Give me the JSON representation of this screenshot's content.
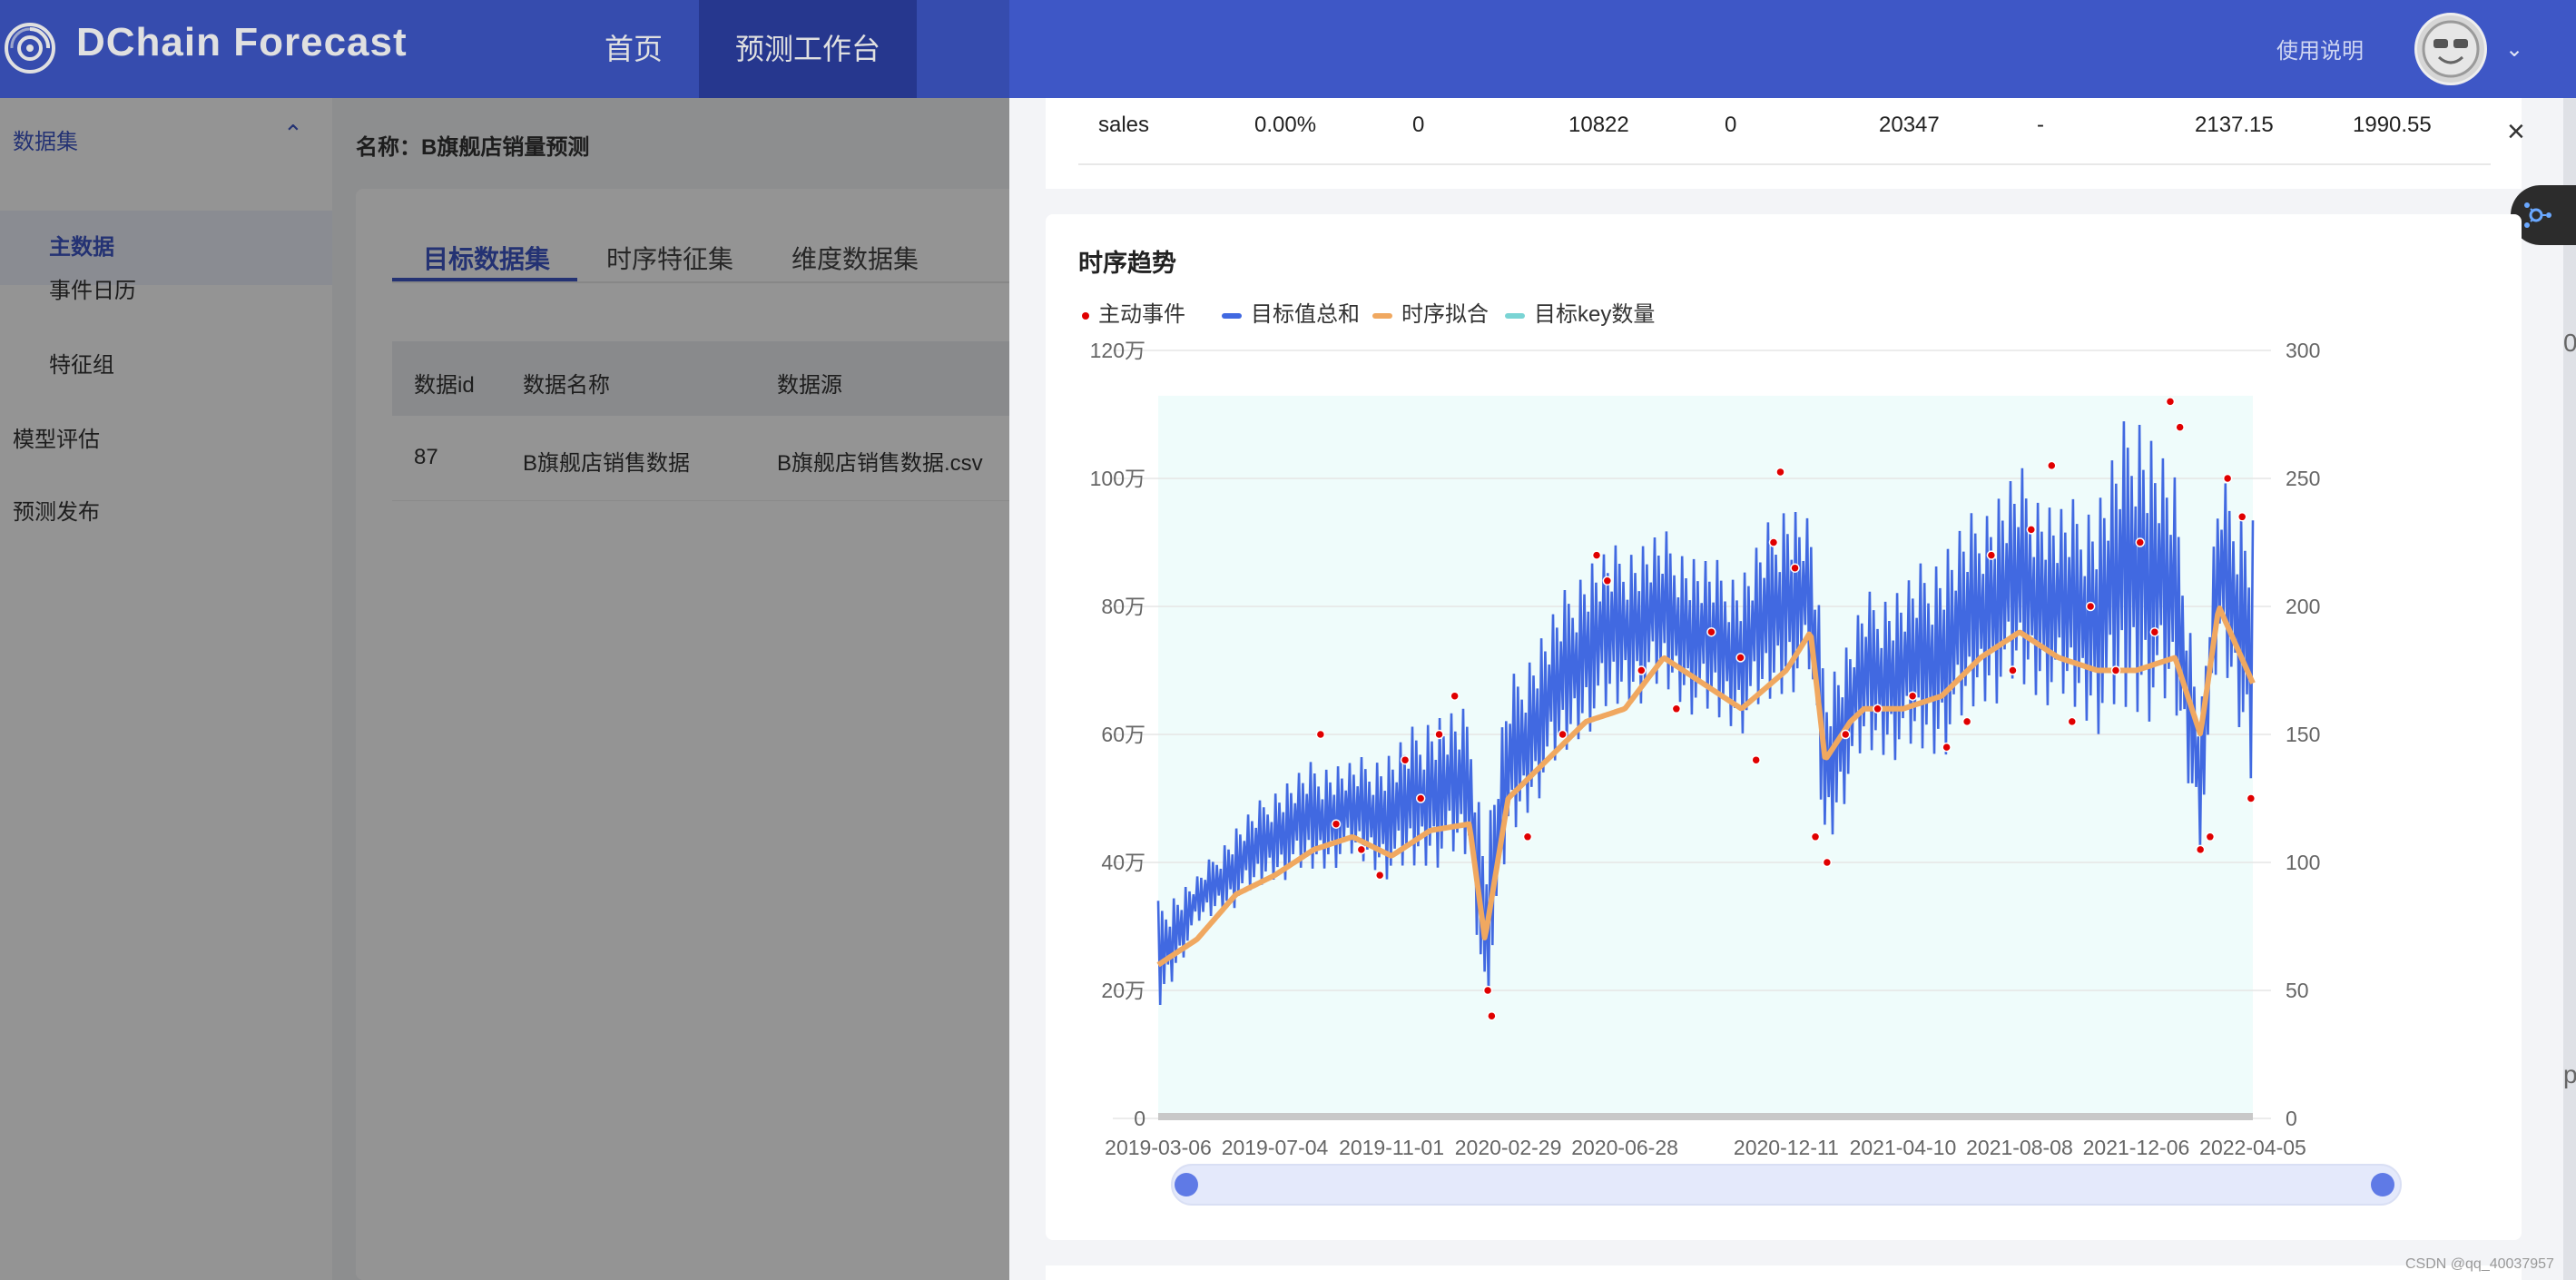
{
  "brand": {
    "name": "DChain Forecast",
    "logo_icon": "swirl-logo-icon"
  },
  "nav": {
    "home": "首页",
    "workbench": "预测工作台",
    "help": "使用说明",
    "avatar_icon": "smiley-avatar-icon",
    "dropdown_icon": "chevron-down-icon"
  },
  "sidebar": {
    "group": "数据集",
    "items": [
      "主数据",
      "事件日历",
      "特征组"
    ],
    "other": [
      "模型评估",
      "预测发布"
    ]
  },
  "main": {
    "dataset_name": "名称：B旗舰店销量预测",
    "tabs": [
      "目标数据集",
      "时序特征集",
      "维度数据集"
    ],
    "table": {
      "headers": [
        "数据id",
        "数据名称",
        "数据源"
      ],
      "rows": [
        [
          "87",
          "B旗舰店销售数据",
          "B旗舰店销售数据.csv"
        ]
      ]
    }
  },
  "drawer": {
    "close_icon": "close-icon",
    "float_icon": "graph-network-icon",
    "stats_row": [
      "sales",
      "0.00%",
      "0",
      "10822",
      "0",
      "20347",
      "-",
      "2137.15",
      "1990.55"
    ],
    "chart_title": "时序趋势",
    "edge_chars": [
      "0",
      "p"
    ],
    "watermark": "CSDN @qq_40037957"
  },
  "colors": {
    "primary": "#3e57c6",
    "series_total": "#4169e1",
    "series_fit": "#f0a860",
    "series_keys": "#7ad4d4",
    "events": "#e00000",
    "plot_bg": "#effcfb"
  },
  "chart_data": {
    "type": "line",
    "title": "时序趋势",
    "legend": [
      "主动事件",
      "目标值总和",
      "时序拟合",
      "目标key数量"
    ],
    "legend_position": "top-left",
    "x_tick_labels": [
      "2019-03-06",
      "2019-07-04",
      "2019-11-01",
      "2020-02-29",
      "2020-06-28",
      "2020-12-11",
      "2021-04-10",
      "2021-08-08",
      "2021-12-06",
      "2022-04-05"
    ],
    "x_range": [
      "2019-03-06",
      "2022-04-05"
    ],
    "y_left_ticks": [
      "0",
      "20万",
      "40万",
      "60万",
      "80万",
      "100万",
      "120万"
    ],
    "y_left_range": [
      0,
      1200000
    ],
    "y_right_ticks": [
      "0",
      "50",
      "100",
      "150",
      "200",
      "250",
      "300"
    ],
    "y_right_range": [
      0,
      300
    ],
    "series": [
      {
        "name": "目标值总和",
        "axis": "left",
        "x": [
          "2019-03-06",
          "2019-04-15",
          "2019-05-25",
          "2019-07-04",
          "2019-08-13",
          "2019-09-22",
          "2019-11-01",
          "2019-12-11",
          "2020-01-20",
          "2020-02-05",
          "2020-02-29",
          "2020-04-09",
          "2020-05-19",
          "2020-06-28",
          "2020-08-07",
          "2020-09-16",
          "2020-10-26",
          "2020-12-11",
          "2021-01-05",
          "2021-01-20",
          "2021-02-15",
          "2021-03-01",
          "2021-04-10",
          "2021-05-20",
          "2021-06-29",
          "2021-08-08",
          "2021-09-17",
          "2021-10-27",
          "2021-12-06",
          "2022-01-15",
          "2022-02-10",
          "2022-03-01",
          "2022-04-05"
        ],
        "y_low": [
          160000,
          300000,
          330000,
          370000,
          380000,
          400000,
          370000,
          390000,
          400000,
          150000,
          420000,
          520000,
          600000,
          640000,
          660000,
          620000,
          600000,
          660000,
          680000,
          400000,
          520000,
          560000,
          560000,
          560000,
          640000,
          660000,
          640000,
          600000,
          620000,
          620000,
          420000,
          720000,
          520000
        ],
        "y_high": [
          340000,
          380000,
          460000,
          520000,
          560000,
          560000,
          580000,
          640000,
          640000,
          440000,
          680000,
          780000,
          880000,
          900000,
          920000,
          880000,
          860000,
          980000,
          940000,
          700000,
          760000,
          820000,
          840000,
          900000,
          960000,
          1020000,
          960000,
          980000,
          1140000,
          1000000,
          640000,
          1000000,
          960000
        ]
      },
      {
        "name": "时序拟合",
        "axis": "left",
        "x": [
          "2019-03-06",
          "2019-04-15",
          "2019-05-25",
          "2019-07-04",
          "2019-08-13",
          "2019-09-22",
          "2019-11-01",
          "2019-12-11",
          "2020-01-20",
          "2020-02-05",
          "2020-02-29",
          "2020-04-09",
          "2020-05-19",
          "2020-06-28",
          "2020-08-07",
          "2020-09-16",
          "2020-10-26",
          "2020-12-11",
          "2021-01-05",
          "2021-01-20",
          "2021-02-15",
          "2021-03-01",
          "2021-04-10",
          "2021-05-20",
          "2021-06-29",
          "2021-08-08",
          "2021-09-17",
          "2021-10-27",
          "2021-12-06",
          "2022-01-15",
          "2022-02-10",
          "2022-03-01",
          "2022-04-05"
        ],
        "y": [
          240000,
          280000,
          350000,
          380000,
          420000,
          440000,
          410000,
          450000,
          460000,
          280000,
          500000,
          560000,
          620000,
          640000,
          720000,
          680000,
          640000,
          700000,
          760000,
          560000,
          620000,
          640000,
          640000,
          660000,
          720000,
          760000,
          720000,
          700000,
          700000,
          720000,
          600000,
          800000,
          680000
        ]
      },
      {
        "name": "目标key数量",
        "axis": "right",
        "x": [],
        "y": []
      },
      {
        "name": "主动事件",
        "type": "scatter",
        "axis": "left",
        "x": [
          "2019-08-20",
          "2019-09-05",
          "2019-10-01",
          "2019-10-20",
          "2019-11-15",
          "2019-12-01",
          "2019-12-20",
          "2020-01-05",
          "2020-02-08",
          "2020-02-12",
          "2020-03-20",
          "2020-04-25",
          "2020-05-30",
          "2020-06-10",
          "2020-07-15",
          "2020-08-20",
          "2020-09-25",
          "2020-10-25",
          "2020-11-10",
          "2020-11-28",
          "2020-12-05",
          "2020-12-20",
          "2021-01-10",
          "2021-01-22",
          "2021-02-10",
          "2021-03-15",
          "2021-04-20",
          "2021-05-25",
          "2021-06-15",
          "2021-07-10",
          "2021-08-01",
          "2021-08-20",
          "2021-09-10",
          "2021-10-01",
          "2021-10-20",
          "2021-11-15",
          "2021-12-10",
          "2021-12-25",
          "2022-01-10",
          "2022-01-20",
          "2022-02-10",
          "2022-02-20",
          "2022-03-10",
          "2022-03-25",
          "2022-04-03"
        ],
        "y": [
          600000,
          460000,
          420000,
          380000,
          560000,
          500000,
          600000,
          660000,
          200000,
          160000,
          440000,
          600000,
          880000,
          840000,
          700000,
          640000,
          760000,
          720000,
          560000,
          900000,
          1010000,
          860000,
          440000,
          400000,
          600000,
          640000,
          660000,
          580000,
          620000,
          880000,
          700000,
          920000,
          1020000,
          620000,
          800000,
          700000,
          900000,
          760000,
          1120000,
          1080000,
          420000,
          440000,
          1000000,
          940000,
          500000
        ]
      }
    ],
    "brush": {
      "start": "2019-03-06",
      "end": "2022-04-05"
    }
  }
}
